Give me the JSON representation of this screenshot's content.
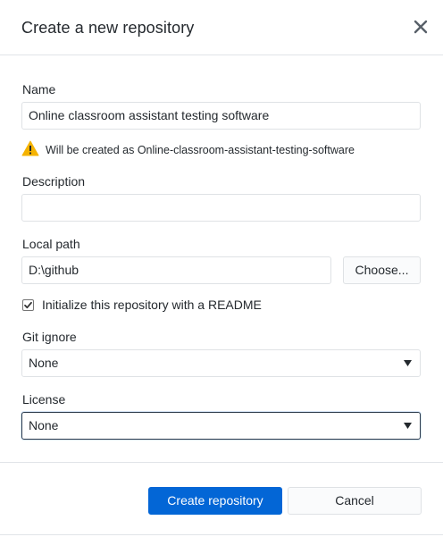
{
  "dialog": {
    "title": "Create a new repository",
    "close_icon": "close-icon"
  },
  "name": {
    "label": "Name",
    "value": "Online classroom assistant testing software",
    "warning_icon": "warning-icon",
    "warning_text": "Will be created as Online-classroom-assistant-testing-software"
  },
  "description": {
    "label": "Description",
    "value": ""
  },
  "local_path": {
    "label": "Local path",
    "value": "D:\\github",
    "choose_label": "Choose..."
  },
  "readme": {
    "label": "Initialize this repository with a README",
    "checked": true
  },
  "gitignore": {
    "label": "Git ignore",
    "selected": "None"
  },
  "license": {
    "label": "License",
    "selected": "None"
  },
  "footer": {
    "create_label": "Create repository",
    "cancel_label": "Cancel"
  },
  "colors": {
    "primary": "#0366d6",
    "warning": "#f5b301",
    "border": "#dfe2e5",
    "text": "#24292e"
  }
}
